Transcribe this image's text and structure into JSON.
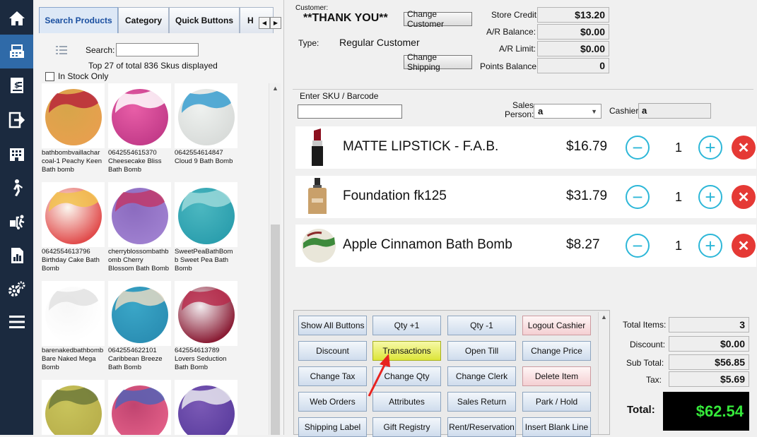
{
  "nav": {
    "items": [
      {
        "id": "home",
        "icon": "home-icon"
      },
      {
        "id": "register",
        "icon": "cash-register-icon"
      },
      {
        "id": "receipt",
        "icon": "receipt-dollar-icon"
      },
      {
        "id": "exit",
        "icon": "sign-out-icon"
      },
      {
        "id": "building",
        "icon": "building-icon"
      },
      {
        "id": "person",
        "icon": "walking-person-icon"
      },
      {
        "id": "delivery",
        "icon": "hand-truck-icon"
      },
      {
        "id": "report",
        "icon": "report-icon"
      },
      {
        "id": "settings",
        "icon": "gears-icon"
      },
      {
        "id": "menu",
        "icon": "hamburger-menu-icon"
      }
    ]
  },
  "tabs": [
    "Search Products",
    "Category",
    "Quick Buttons",
    "H"
  ],
  "search": {
    "label": "Search:",
    "value": "",
    "sku_info": "Top 27 of total 836 Skus displayed",
    "in_stock": "In Stock Only"
  },
  "products": [
    {
      "line1": "bathbombvaillachar",
      "line2": "coal-1 Peachy Keen",
      "line3": "Bath bomb",
      "colors": [
        "#d7a54a",
        "#b8273a",
        "#e7a04e"
      ]
    },
    {
      "line1": "0642554615370",
      "line2": "Cheesecake Bliss",
      "line3": "Bath Bomb",
      "colors": [
        "#e85ea7",
        "#ffffff",
        "#c43c8a"
      ]
    },
    {
      "line1": "0642554614847",
      "line2": "Cloud 9 Bath Bomb",
      "line3": "",
      "colors": [
        "#eef1ef",
        "#3a9fd0",
        "#d9dcda"
      ]
    },
    {
      "line1": "0642554613796",
      "line2": "Birthday Cake Bath",
      "line3": "Bomb",
      "colors": [
        "#fbf7ef",
        "#f2c24d",
        "#e14c4c"
      ]
    },
    {
      "line1": "cherryblossombathb",
      "line2": "omb Cherry",
      "line3": "Blossom Bath Bomb",
      "colors": [
        "#8b6bbf",
        "#c0386b",
        "#9e7fcf"
      ]
    },
    {
      "line1": "SweetPeaBathBom",
      "line2": "b Sweet Pea Bath",
      "line3": "Bomb",
      "colors": [
        "#4bb7c0",
        "#9ad8d9",
        "#2c9fae"
      ]
    },
    {
      "line1": "barenakedbathbomb",
      "line2": "Bare Naked Mega",
      "line3": "Bomb",
      "colors": [
        "#f7f7f7",
        "#e2e2e2",
        "#ffffff"
      ]
    },
    {
      "line1": "0642554622101",
      "line2": "Caribbean Breeze",
      "line3": "Bath Bomb",
      "colors": [
        "#3aa6c7",
        "#e3d9c4",
        "#2b8fb4"
      ]
    },
    {
      "line1": "642554613789",
      "line2": "Lovers Seduction",
      "line3": "Bath Bomb",
      "colors": [
        "#f2ecef",
        "#b62c4b",
        "#8a1d35"
      ]
    },
    {
      "line1": "",
      "line2": "",
      "line3": "",
      "colors": [
        "#c8c35b",
        "#6f7a3a",
        "#b9b04c"
      ]
    },
    {
      "line1": "",
      "line2": "",
      "line3": "",
      "colors": [
        "#c04470",
        "#5561b5",
        "#e05d86"
      ]
    },
    {
      "line1": "",
      "line2": "",
      "line3": "",
      "colors": [
        "#7a59b5",
        "#e8e6ef",
        "#5d3fa0"
      ]
    }
  ],
  "customer": {
    "label": "Customer:",
    "name": "**THANK YOU**",
    "change_customer": "Change Customer",
    "type_label": "Type:",
    "type_value": "Regular Customer",
    "change_shipping": "Change Shipping",
    "store_credit_label": "Store Credit:",
    "store_credit": "$13.20",
    "ar_balance_label": "A/R Balance:",
    "ar_balance": "$0.00",
    "ar_limit_label": "A/R Limit:",
    "ar_limit": "$0.00",
    "points_label": "Points Balance:",
    "points": "0"
  },
  "entry": {
    "sku_label": "Enter SKU / Barcode",
    "sku_value": "",
    "sales_label_1": "Sales",
    "sales_label_2": "Person:",
    "sales_value": "a",
    "cashier_label": "Cashier:",
    "cashier_value": "a"
  },
  "cart": [
    {
      "name": "MATTE LIPSTICK - F.A.B.",
      "price": "$16.79",
      "qty": "1",
      "icon": "lipstick-icon"
    },
    {
      "name": "Foundation fk125",
      "price": "$31.79",
      "qty": "1",
      "icon": "foundation-bottle-icon"
    },
    {
      "name": "Apple Cinnamon Bath Bomb",
      "price": "$8.27",
      "qty": "1",
      "icon": "bath-bomb-icon"
    }
  ],
  "buttons": [
    [
      "Show All Buttons",
      "Qty +1",
      "Qty -1",
      "Logout Cashier"
    ],
    [
      "Discount",
      "Transactions",
      "Open Till",
      "Change Price"
    ],
    [
      "Change Tax",
      "Change Qty",
      "Change Clerk",
      "Delete Item"
    ],
    [
      "Web Orders",
      "Attributes",
      "Sales Return",
      "Park / Hold"
    ],
    [
      "Shipping Label",
      "Gift Registry",
      "Rent/Reservation",
      "Insert Blank Line"
    ]
  ],
  "totals": {
    "items_label": "Total Items:",
    "items": "3",
    "discount_label": "Discount:",
    "discount": "$0.00",
    "subtotal_label": "Sub Total:",
    "subtotal": "$56.85",
    "tax_label": "Tax:",
    "tax": "$5.69",
    "total_label": "Total:",
    "total": "$62.54",
    "total_color": "#35e83a"
  }
}
